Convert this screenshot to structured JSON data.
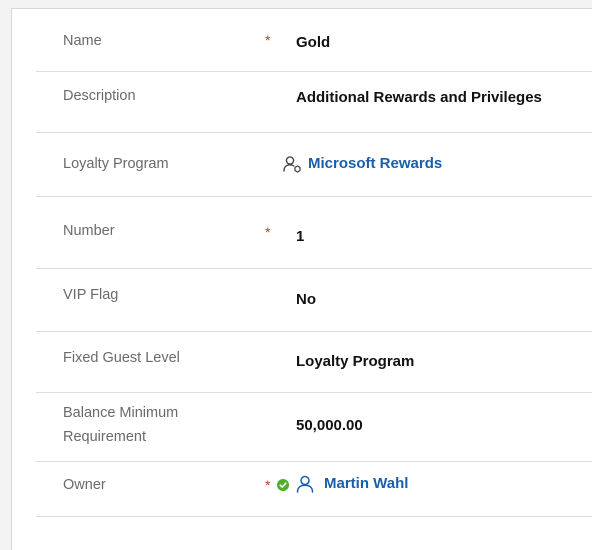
{
  "fields": {
    "name": {
      "label": "Name",
      "value": "Gold",
      "required_mark": "*"
    },
    "description": {
      "label": "Description",
      "value": "Additional Rewards and Privileges"
    },
    "loyalty_program": {
      "label": "Loyalty Program",
      "value": "Microsoft Rewards",
      "icon": "account-lookup-icon"
    },
    "number": {
      "label": "Number",
      "value": "1",
      "required_mark": "*"
    },
    "vip_flag": {
      "label": "VIP Flag",
      "value": "No"
    },
    "fixed_guest_level": {
      "label": "Fixed Guest Level",
      "value": "Loyalty Program"
    },
    "balance_minimum": {
      "label_line1": "Balance Minimum",
      "label_line2": "Requirement",
      "value": "50,000.00"
    },
    "owner": {
      "label": "Owner",
      "value": "Martin Wahl",
      "required_mark": "*",
      "status_icon": "available-status-icon",
      "icon": "person-icon"
    }
  },
  "colors": {
    "link": "#1b5fa8",
    "required": "#c0392b",
    "status_available": "#4caf27"
  }
}
